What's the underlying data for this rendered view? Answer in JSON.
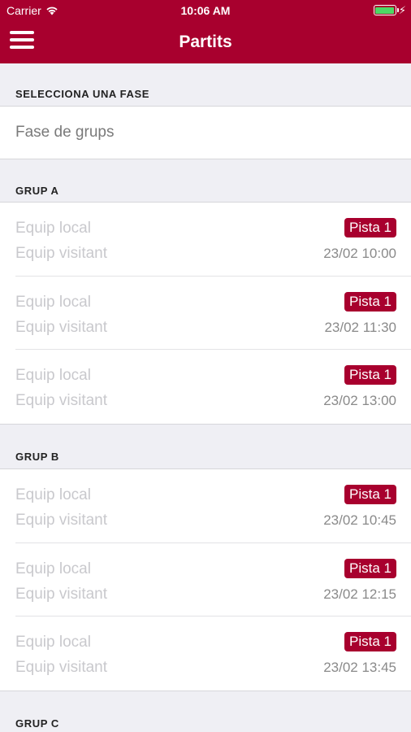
{
  "status_bar": {
    "carrier": "Carrier",
    "time": "10:06 AM",
    "battery_level": 1.0
  },
  "nav": {
    "title": "Partits",
    "menu_icon": "hamburger-icon",
    "color": "#a8002e"
  },
  "phase": {
    "header": "SELECCIONA UNA FASE",
    "selected": "Fase de grups"
  },
  "groups": [
    {
      "name": "GRUP A",
      "matches": [
        {
          "home": "Equip local",
          "away": "Equip visitant",
          "court": "Pista 1",
          "datetime": "23/02 10:00"
        },
        {
          "home": "Equip local",
          "away": "Equip visitant",
          "court": "Pista 1",
          "datetime": "23/02 11:30"
        },
        {
          "home": "Equip local",
          "away": "Equip visitant",
          "court": "Pista 1",
          "datetime": "23/02 13:00"
        }
      ]
    },
    {
      "name": "GRUP B",
      "matches": [
        {
          "home": "Equip local",
          "away": "Equip visitant",
          "court": "Pista 1",
          "datetime": "23/02 10:45"
        },
        {
          "home": "Equip local",
          "away": "Equip visitant",
          "court": "Pista 1",
          "datetime": "23/02 12:15"
        },
        {
          "home": "Equip local",
          "away": "Equip visitant",
          "court": "Pista 1",
          "datetime": "23/02 13:45"
        }
      ]
    },
    {
      "name": "GRUP C",
      "matches": []
    }
  ]
}
